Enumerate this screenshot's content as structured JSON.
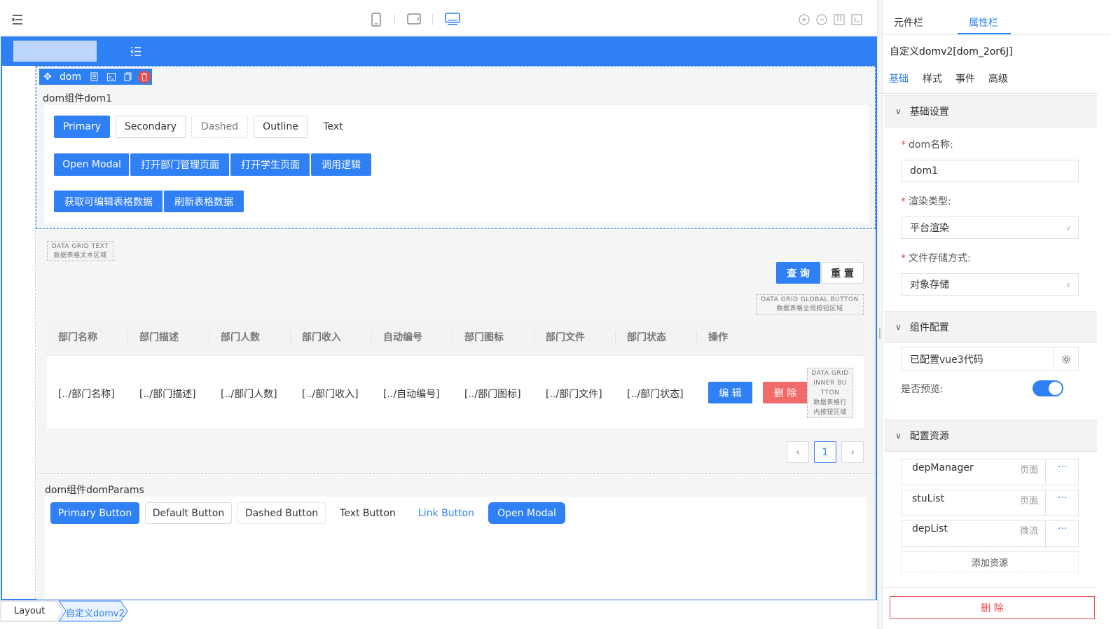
{
  "toolbar": {
    "menu_icon": "menu-icon",
    "devices": [
      "mobile-icon",
      "tablet-icon",
      "desktop-icon"
    ],
    "tools": [
      "zoom-in-icon",
      "zoom-out-icon",
      "grid-icon",
      "code-icon"
    ]
  },
  "selection": {
    "name": "dom"
  },
  "dom1": {
    "title": "dom组件dom1",
    "row1": [
      "Primary",
      "Secondary",
      "Dashed",
      "Outline",
      "Text"
    ],
    "row2": [
      "Open Modal",
      "打开部门管理页面",
      "打开学生页面",
      "调用逻辑"
    ],
    "row3": [
      "获取可编辑表格数据",
      "刷新表格数据"
    ]
  },
  "grid": {
    "text_placeholder": {
      "line1": "DATA GRID TEXT",
      "line2": "数据表格文本区域"
    },
    "query": "查 询",
    "reset": "重 置",
    "global_placeholder": {
      "line1": "DATA GRID GLOBAL BUTTON",
      "line2": "数据表格全局按钮区域"
    },
    "columns": [
      "部门名称",
      "部门描述",
      "部门人数",
      "部门收入",
      "自动编号",
      "部门图标",
      "部门文件",
      "部门状态",
      "操作"
    ],
    "row": [
      "[../部门名称]",
      "[../部门描述]",
      "[../部门人数]",
      "[../部门收入]",
      "[../自动编号]",
      "[../部门图标]",
      "[../部门文件]",
      "[../部门状态]"
    ],
    "edit": "编 辑",
    "delete": "删 除",
    "inner_placeholder": {
      "l1": "DATA GRID",
      "l2": "INNER BU",
      "l3": "TTON",
      "l4": "数据表格行",
      "l5": "内按钮区域"
    },
    "page": "1"
  },
  "dom_params": {
    "title": "dom组件domParams",
    "buttons": [
      "Primary Button",
      "Default Button",
      "Dashed Button",
      "Text Button",
      "Link Button",
      "Open Modal"
    ]
  },
  "breadcrumb": [
    "Layout",
    "自定义domv2"
  ],
  "panel": {
    "tabs": [
      "元件栏",
      "属性栏"
    ],
    "title": "自定义domv2[dom_2or6J]",
    "subtabs": [
      "基础",
      "样式",
      "事件",
      "高级"
    ],
    "basic_settings": "基础设置",
    "dom_name_label": "dom名称:",
    "dom_name_value": "dom1",
    "render_type_label": "渲染类型:",
    "render_type_value": "平台渲染",
    "storage_label": "文件存储方式:",
    "storage_value": "对象存储",
    "component_config": "组件配置",
    "vue3_value": "已配置vue3代码",
    "preview_label": "是否预览:",
    "preview_on": true,
    "resources_title": "配置资源",
    "resources": [
      {
        "name": "depManager",
        "type": "页面"
      },
      {
        "name": "stuList",
        "type": "页面"
      },
      {
        "name": "depList",
        "type": "微流"
      }
    ],
    "more": "···",
    "add_resource": "添加资源",
    "delete": "删 除"
  },
  "colors": {
    "accent": "#2f7ff5",
    "danger": "#f16b6b",
    "danger_text": "#e84a4a"
  }
}
